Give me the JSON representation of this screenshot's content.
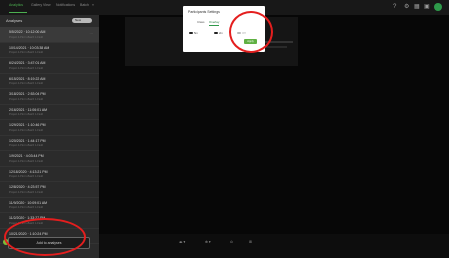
{
  "topbar": {
    "tabs": [
      "Analytics",
      "Gallery View",
      "Notifications",
      "Batch"
    ],
    "overflow_label": "»",
    "right_icons": [
      "help-icon",
      "gear-icon",
      "grid-icon",
      "image-icon"
    ],
    "help_glyph": "?",
    "gear_glyph": "⚙",
    "grid_glyph": "▦",
    "image_glyph": "▣"
  },
  "sidebar": {
    "header": "Analyses",
    "pill": "New",
    "items": [
      {
        "title": "5/5/2022 · 10:12:00 AM",
        "subtitle": "Project 4-Plot 1-Batch 1-Field"
      },
      {
        "title": "10/14/2021 · 10:03:38 AM",
        "subtitle": "Project 4-Plot 1-Batch 1-Field"
      },
      {
        "title": "6/24/2021 · 3:47:01 AM",
        "subtitle": "Project 4-Plot 1-Batch 1-Field"
      },
      {
        "title": "6/15/2021 · 8:19:22 AM",
        "subtitle": "Project 4-Plot 1-Batch 1-Field"
      },
      {
        "title": "3/18/2021 · 2:53:04 PM",
        "subtitle": "Project 4-Plot 1-Batch 1-Field"
      },
      {
        "title": "2/16/2021 · 11:06:01 AM",
        "subtitle": "Project 4-Plot 1-Batch 1-Field"
      },
      {
        "title": "1/29/2021 · 1:10:46 PM",
        "subtitle": "Project 4-Plot 1-Batch 1-Field"
      },
      {
        "title": "1/20/2021 · 1:44:17 PM",
        "subtitle": "Project 4-Plot 1-Batch 1-Field"
      },
      {
        "title": "1/9/2021 · 4:03:44 PM",
        "subtitle": "Project 4-Plot 1-Batch 1-Field"
      },
      {
        "title": "12/18/2020 · 4:13:21 PM",
        "subtitle": "Project 4-Plot 1-Batch 1-Field"
      },
      {
        "title": "12/8/2020 · 4:23:57 PM",
        "subtitle": "Project 4-Plot 1-Batch 1-Field"
      },
      {
        "title": "11/9/2020 · 10:09:01 AM",
        "subtitle": "Project 4-Plot 1-Batch 1-Field"
      },
      {
        "title": "11/2/2020 · 1:33:27 PM",
        "subtitle": "Project 4-Plot 1-Batch 1-Field"
      },
      {
        "title": "10/21/2020 · 1:10:24 PM",
        "subtitle": "Project 4-Plot 1-Batch 1-Field"
      }
    ],
    "dots": "⋯",
    "add_button": "Add to analyses"
  },
  "modal": {
    "title": "Participants Settings",
    "tabs": [
      "Class",
      "Overlay"
    ],
    "options": [
      {
        "label": "5m",
        "state": "on"
      },
      {
        "label": "2m",
        "state": "on"
      },
      {
        "label": "Off",
        "state": "off"
      }
    ],
    "apply": "Apply"
  },
  "bottom": {
    "controls": [
      "◂▸ ▾",
      "⊕ ▾",
      "⊙",
      "⊞"
    ]
  }
}
